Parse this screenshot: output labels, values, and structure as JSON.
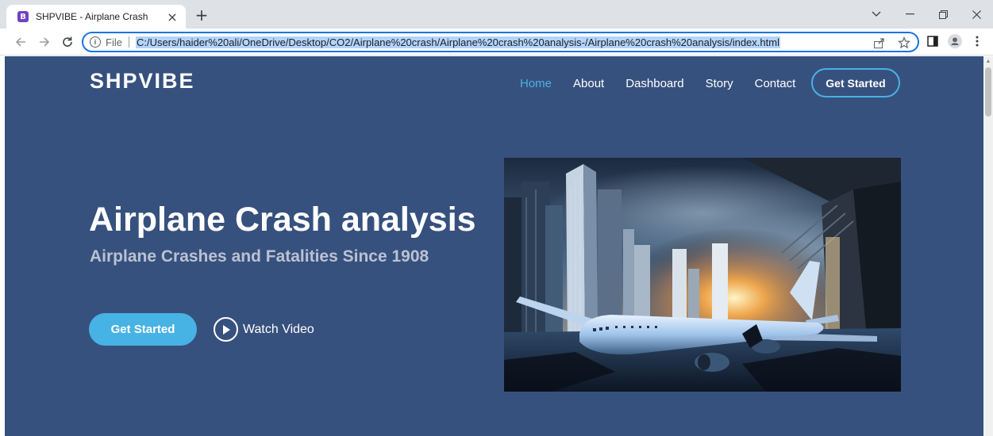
{
  "browser": {
    "tab": {
      "favicon_letter": "B",
      "title": "SHPVIBE - Airplane Crash",
      "close_glyph": "×"
    },
    "new_tab_glyph": "+",
    "address_bar": {
      "scheme_label": "File",
      "url": "C:/Users/haider%20ali/OneDrive/Desktop/CO2/Airplane%20crash/Airplane%20crash%20analysis-/Airplane%20crash%20analysis/index.html"
    }
  },
  "header": {
    "logo": "SHPVIBE",
    "nav": [
      {
        "label": "Home",
        "active": true
      },
      {
        "label": "About",
        "active": false
      },
      {
        "label": "Dashboard",
        "active": false
      },
      {
        "label": "Story",
        "active": false
      },
      {
        "label": "Contact",
        "active": false
      }
    ],
    "cta": "Get Started"
  },
  "hero": {
    "title": "Airplane Crash analysis",
    "subtitle": "Airplane Crashes and Fatalities Since 1908",
    "primary_button": "Get Started",
    "watch_label": "Watch Video",
    "image_icon": "airplane-crash-city-illustration"
  },
  "colors": {
    "page_background": "#37517e",
    "accent": "#47b2e4",
    "address_focus": "#1a73e8"
  }
}
